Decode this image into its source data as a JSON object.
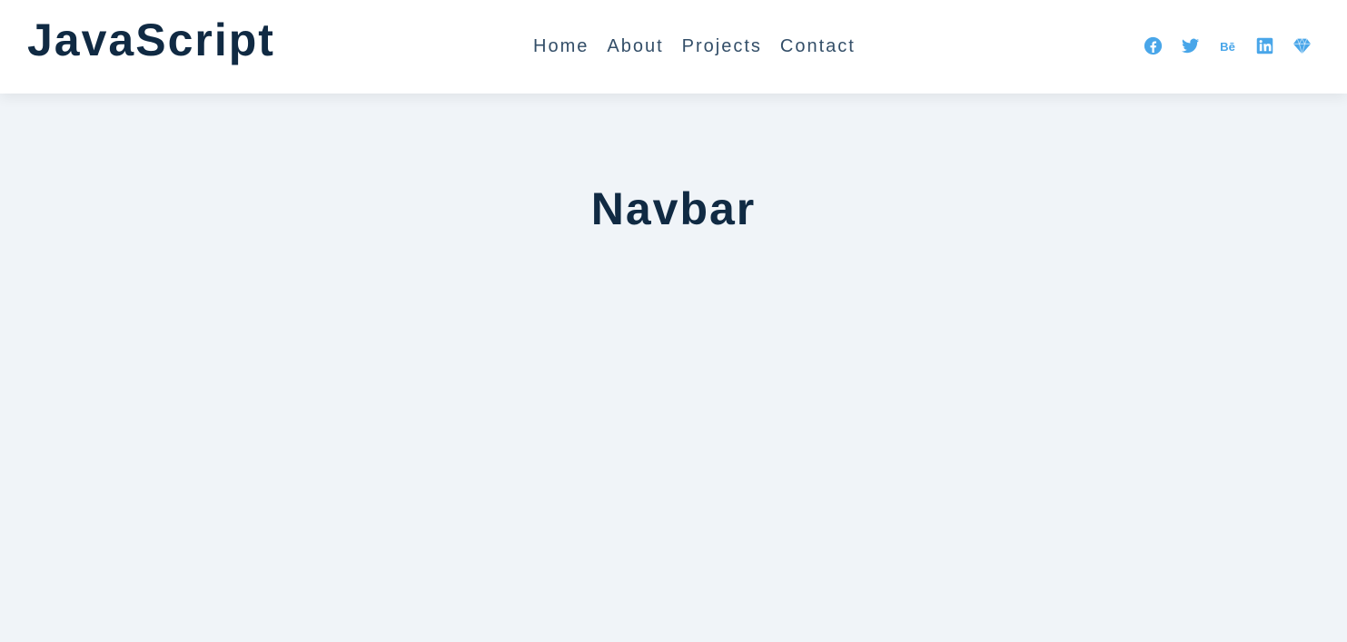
{
  "navbar": {
    "logo": "JavaScript",
    "links": [
      {
        "label": "Home"
      },
      {
        "label": "About"
      },
      {
        "label": "Projects"
      },
      {
        "label": "Contact"
      }
    ],
    "social_icons": [
      "facebook-icon",
      "twitter-icon",
      "behance-icon",
      "linkedin-icon",
      "sketch-icon"
    ]
  },
  "hero": {
    "title": "Navbar"
  },
  "colors": {
    "background": "#f0f4f8",
    "navbar_bg": "#ffffff",
    "primary_text": "#102a43",
    "link_text": "#334e68",
    "icon_accent": "#49a6e9"
  }
}
